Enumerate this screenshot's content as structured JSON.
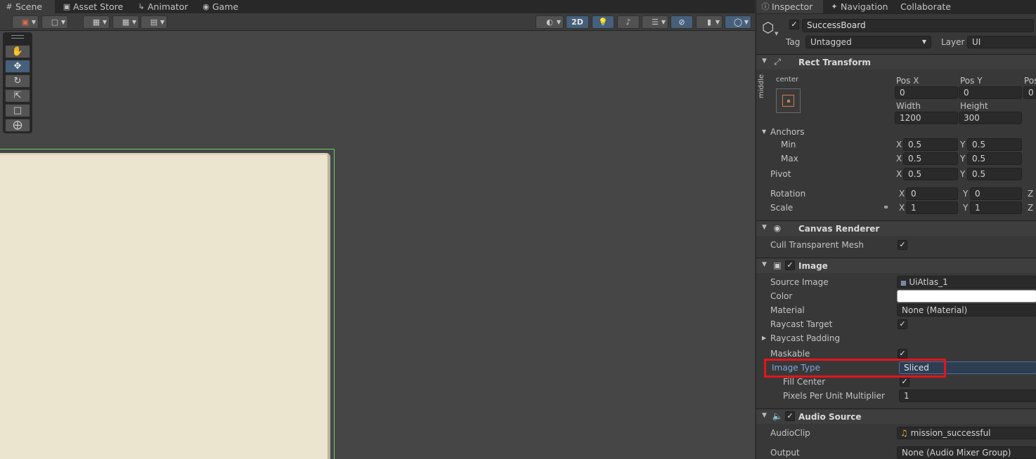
{
  "tabs": [
    {
      "label": "Scene",
      "icon": "grid-icon",
      "active": true
    },
    {
      "label": "Asset Store",
      "icon": "shopping-bag-icon"
    },
    {
      "label": "Animator",
      "icon": "animator-icon"
    },
    {
      "label": "Game",
      "icon": "gamepad-icon"
    }
  ],
  "scene_toolbar": {
    "two_d_label": "2D"
  },
  "inspector_tabs": [
    {
      "label": "Inspector",
      "icon": "info-icon",
      "active": true
    },
    {
      "label": "Navigation",
      "icon": "navigation-icon"
    },
    {
      "label": "Collaborate",
      "icon": ""
    }
  ],
  "object": {
    "name": "SuccessBoard",
    "tag_label": "Tag",
    "tag_value": "Untagged",
    "layer_label": "Layer",
    "layer_value": "UI"
  },
  "rect_transform": {
    "title": "Rect Transform",
    "anchor_h": "center",
    "anchor_v": "middle",
    "pos_x_label": "Pos X",
    "pos_x": "0",
    "pos_y_label": "Pos Y",
    "pos_y": "0",
    "pos_z_label": "Pos",
    "pos_z": "0",
    "width_label": "Width",
    "width": "1200",
    "height_label": "Height",
    "height": "300",
    "anchors_label": "Anchors",
    "min_label": "Min",
    "min_x": "0.5",
    "min_y": "0.5",
    "max_label": "Max",
    "max_x": "0.5",
    "max_y": "0.5",
    "pivot_label": "Pivot",
    "pivot_x": "0.5",
    "pivot_y": "0.5",
    "rotation_label": "Rotation",
    "rot_x": "0",
    "rot_y": "0",
    "scale_label": "Scale",
    "scale_x": "1",
    "scale_y": "1",
    "axis_x": "X",
    "axis_y": "Y",
    "axis_z": "Z"
  },
  "canvas_renderer": {
    "title": "Canvas Renderer",
    "cull_label": "Cull Transparent Mesh"
  },
  "image": {
    "title": "Image",
    "source_label": "Source Image",
    "source_value": "UiAtlas_1",
    "color_label": "Color",
    "color_value": "#ffffff",
    "material_label": "Material",
    "material_value": "None (Material)",
    "raycast_target_label": "Raycast Target",
    "raycast_padding_label": "Raycast Padding",
    "maskable_label": "Maskable",
    "image_type_label": "Image Type",
    "image_type_value": "Sliced",
    "fill_center_label": "Fill Center",
    "ppu_label": "Pixels Per Unit Multiplier",
    "ppu_value": "1"
  },
  "audio_source": {
    "title": "Audio Source",
    "clip_label": "AudioClip",
    "clip_value": "mission_successful",
    "output_label": "Output",
    "output_value": "None (Audio Mixer Group)"
  },
  "colors": {
    "highlight": "#e5141d",
    "selection_outline": "#6ad06a",
    "board_fill": "#ebe5d0"
  }
}
